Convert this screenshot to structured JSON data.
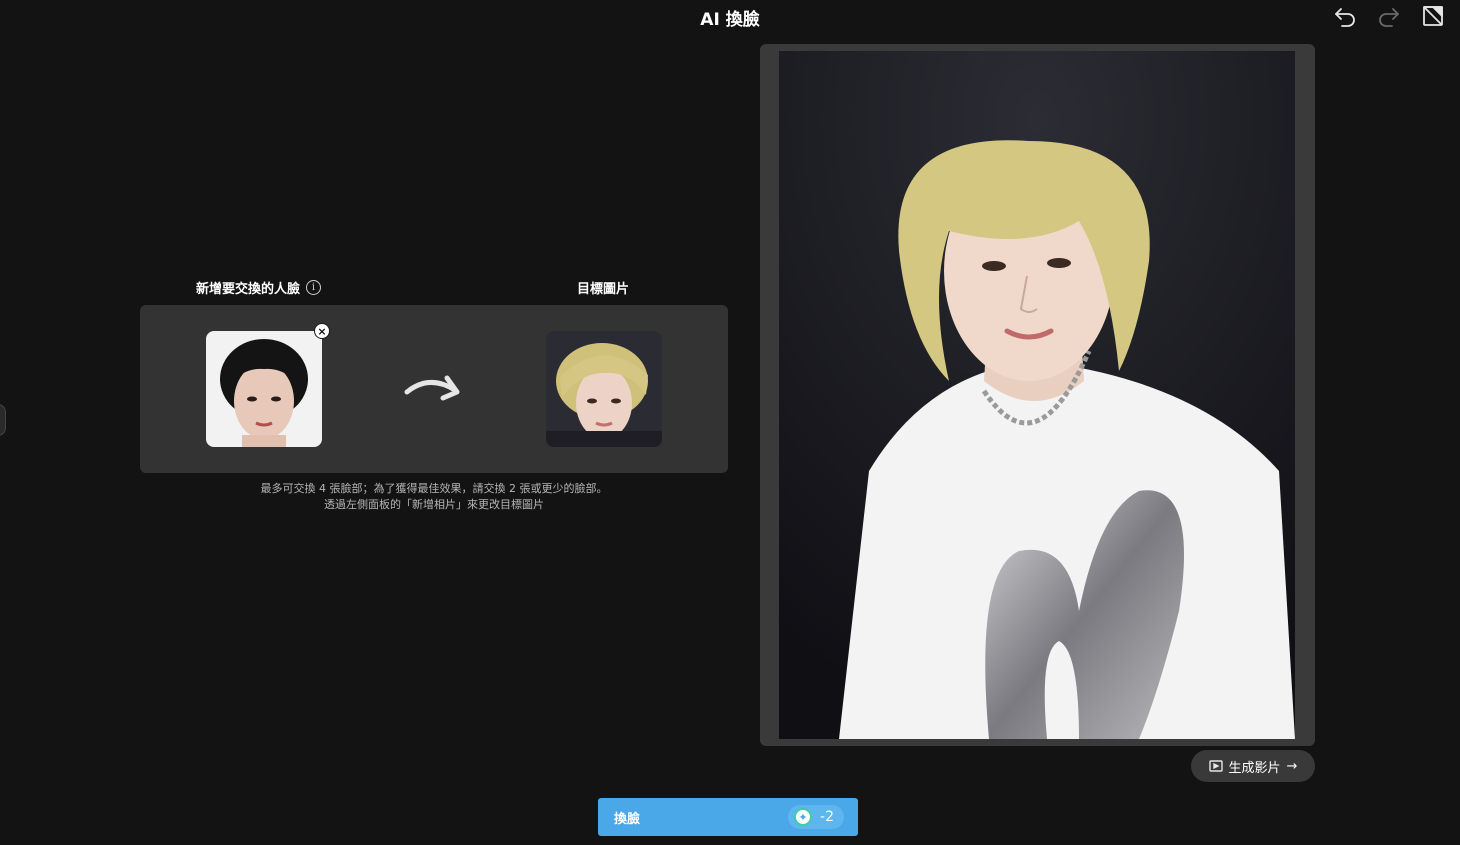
{
  "header": {
    "title": "AI 換臉",
    "undo_icon": "undo-icon",
    "redo_icon": "redo-icon",
    "compare_icon": "compare-icon"
  },
  "faces": {
    "source_label": "新增要交換的人臉",
    "info_icon": "info-icon",
    "info_glyph": "i",
    "target_label": "目標圖片",
    "remove_glyph": "×",
    "hint_line1": "最多可交換 4 張臉部；為了獲得最佳效果，請交換 2 張或更少的臉部。",
    "hint_line2": "透過左側面板的「新增相片」來更改目標圖片"
  },
  "preview": {
    "generate_video_label": "生成影片",
    "generate_video_icon": "video-icon",
    "arrow_glyph": "→"
  },
  "action": {
    "swap_label": "換臉",
    "credit_cost": "-2",
    "credit_glyph": "✦"
  },
  "colors": {
    "background": "#131313",
    "panel": "#333333",
    "primary": "#4aa8e8"
  }
}
